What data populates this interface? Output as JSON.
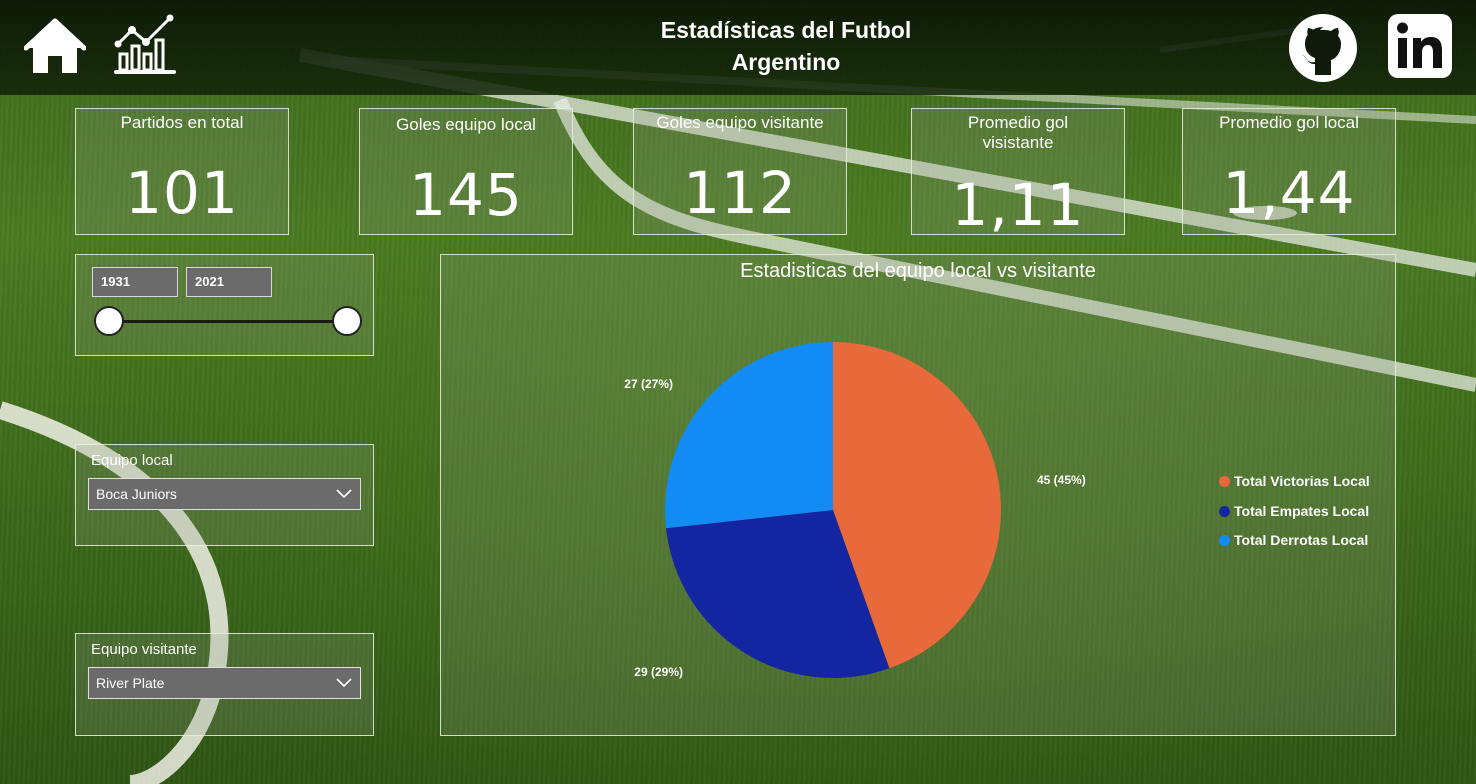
{
  "header": {
    "title": "Estadísticas del Futbol\nArgentino",
    "icons": [
      "home-icon",
      "line-chart-icon",
      "github-icon",
      "linkedin-icon"
    ]
  },
  "kpis": [
    {
      "label": "Partidos en total",
      "value": "101"
    },
    {
      "label": "Goles equipo local",
      "value": "145"
    },
    {
      "label": "Goles equipo visitante",
      "value": "112"
    },
    {
      "label": "Promedio gol visistante",
      "value": "1,11"
    },
    {
      "label": "Promedio gol local",
      "value": "1,44"
    }
  ],
  "year_slider": {
    "start": "1931",
    "end": "2021"
  },
  "filters": {
    "local": {
      "label": "Equipo local",
      "value": "Boca Juniors"
    },
    "visitor": {
      "label": "Equipo visitante",
      "value": "River Plate"
    }
  },
  "colors": {
    "victorias": "#E8693A",
    "empates": "#1325A0",
    "derrotas": "#128BF4"
  },
  "chart_data": {
    "type": "pie",
    "title": "Estadisticas del equipo local vs visitante",
    "categories": [
      "Total Victorias Local",
      "Total Empates Local",
      "Total Derrotas Local"
    ],
    "values": [
      45,
      29,
      27
    ],
    "labels": [
      "45 (45%)",
      "29 (29%)",
      "27 (27%)"
    ],
    "legend_position": "right"
  }
}
